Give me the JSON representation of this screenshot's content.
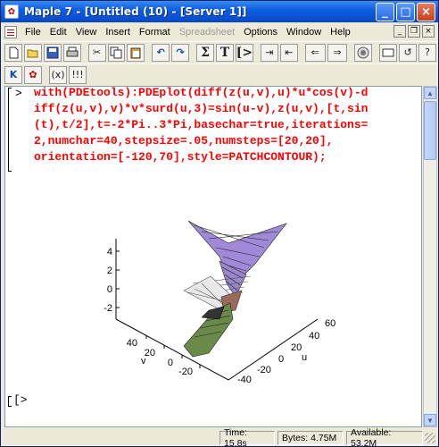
{
  "window": {
    "title": "Maple 7 - [Untitled (10) - [Server 1]]",
    "minimize": "_",
    "maximize": "□",
    "close": "×"
  },
  "menu": {
    "items": [
      {
        "label": "File",
        "enabled": true
      },
      {
        "label": "Edit",
        "enabled": true
      },
      {
        "label": "View",
        "enabled": true
      },
      {
        "label": "Insert",
        "enabled": true
      },
      {
        "label": "Format",
        "enabled": true
      },
      {
        "label": "Spreadsheet",
        "enabled": false
      },
      {
        "label": "Options",
        "enabled": true
      },
      {
        "label": "Window",
        "enabled": true
      },
      {
        "label": "Help",
        "enabled": true
      }
    ]
  },
  "toolbar_secondary": {
    "k_label": "K",
    "paren_label": "(x)",
    "bang_label": "!!!"
  },
  "worksheet": {
    "prompt": ">",
    "command_lines": [
      "with(PDEtools):PDEplot(diff(z(u,v),u)*u*cos(v)-d",
      "iff(z(u,v),v)*v*surd(u,3)=sin(u-v),z(u,v),[t,sin",
      "(t),t/2],t=-2*Pi..3*Pi,basechar=true,iterations=",
      "2,numchar=40,stepsize=.05,numsteps=[20,20],",
      "orientation=[-120,70],style=PATCHCONTOUR);"
    ],
    "empty_prompt": "[>"
  },
  "plot": {
    "z_ticks": [
      "4",
      "2",
      "0",
      "-2"
    ],
    "v_ticks": [
      "40",
      "20",
      "0",
      "-20"
    ],
    "v_label": "v",
    "u_ticks": [
      "60",
      "40",
      "20",
      "0",
      "-20",
      "-40"
    ],
    "u_label": "u",
    "surface_colors": {
      "top": "#a08ad8",
      "bottom": "#6a8a4a"
    }
  },
  "status": {
    "time": "Time: 15.8s",
    "bytes": "Bytes: 4.75M",
    "available": "Available: 53.2M"
  }
}
